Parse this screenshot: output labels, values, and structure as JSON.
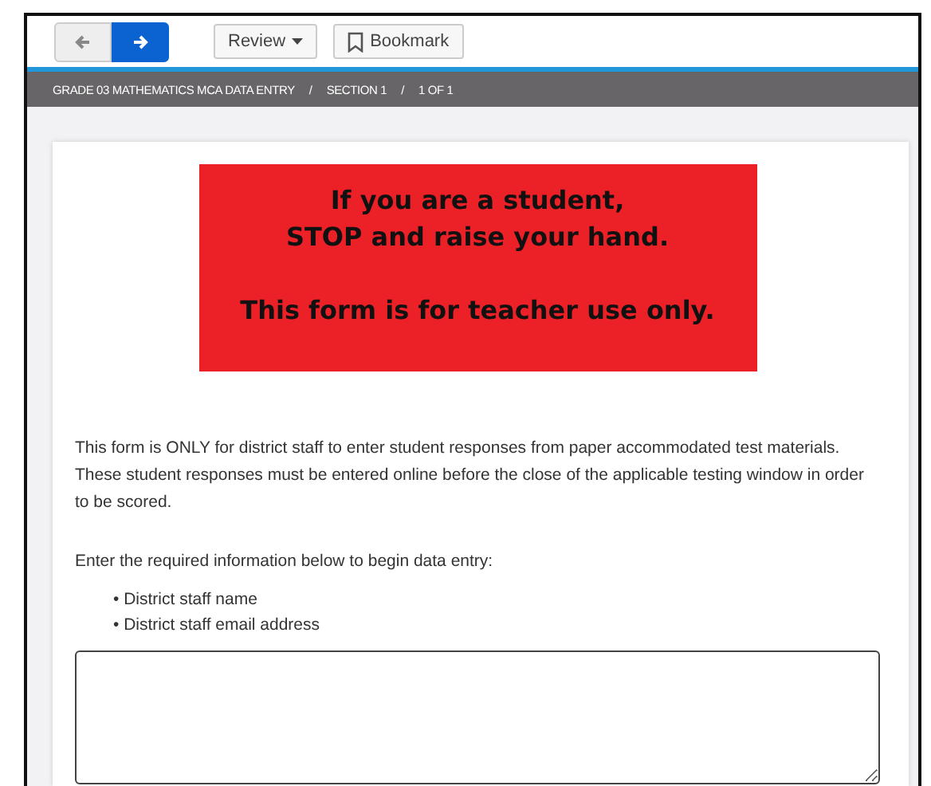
{
  "toolbar": {
    "nav_buttons": [
      {
        "kind": "back",
        "disabled": true
      },
      {
        "kind": "forward",
        "disabled": false
      }
    ],
    "review_button": {
      "label": "Review"
    },
    "bookmark_button": {
      "label": "Bookmark"
    }
  },
  "breadcrumb": {
    "separator": "/",
    "items": [
      "GRADE 03 MATHEMATICS MCA DATA ENTRY",
      "SECTION 1",
      "1 OF 1"
    ]
  },
  "warning": {
    "lines": [
      "If you are a student,",
      "STOP and raise your hand."
    ],
    "footer": "This form is for teacher use only."
  },
  "intro": "This form is ONLY for district staff to enter student responses from paper accommodated test materials. These student responses must be entered online before the close of the applicable testing window in order to be scored.",
  "instructions": "Enter the required information below to begin data entry:",
  "required_items": [
    "• District staff name",
    "• District staff email address"
  ]
}
